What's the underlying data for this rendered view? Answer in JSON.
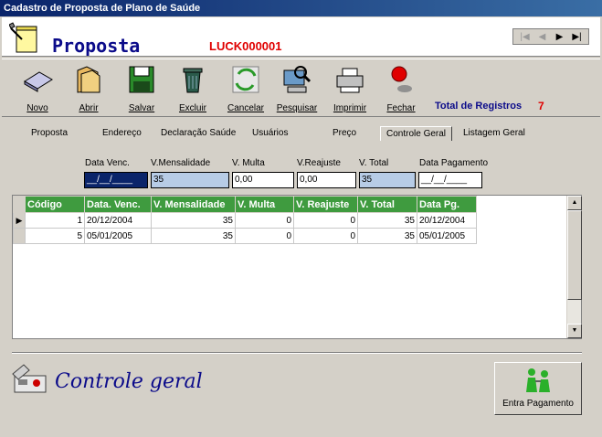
{
  "window": {
    "title": "Cadastro de Proposta de Plano de Saúde"
  },
  "header": {
    "title": "Proposta",
    "code": "LUCK000001"
  },
  "nav": {
    "first": "|◀",
    "prev": "◀",
    "next": "▶",
    "last": "▶|"
  },
  "toolbar": {
    "novo": "Novo",
    "abrir": "Abrir",
    "salvar": "Salvar",
    "excluir": "Excluir",
    "cancelar": "Cancelar",
    "pesquisar": "Pesquisar",
    "imprimir": "Imprimir",
    "fechar": "Fechar",
    "total_label": "Total de Registros",
    "total_value": "7"
  },
  "tabs": [
    "Proposta",
    "Endereço",
    "Declaração Saúde",
    "Usuários",
    "Preço",
    "Controle Geral",
    "Listagem Geral"
  ],
  "form": {
    "labels": {
      "data_venc": "Data Venc.",
      "mensalidade": "V.Mensalidade",
      "multa": "V. Multa",
      "reajuste": "V.Reajuste",
      "total": "V. Total",
      "data_pagamento": "Data Pagamento"
    },
    "values": {
      "data_venc": "__/__/____",
      "mensalidade": "35",
      "multa": "0,00",
      "reajuste": "0,00",
      "total": "35",
      "data_pagamento": "__/__/____"
    }
  },
  "grid": {
    "columns": [
      "Código",
      "Data. Venc.",
      "V. Mensalidade",
      "V. Multa",
      "V. Reajuste",
      "V. Total",
      "Data Pg."
    ],
    "rows": [
      [
        "1",
        "20/12/2004",
        "35",
        "0",
        "0",
        "35",
        "20/12/2004"
      ],
      [
        "5",
        "05/01/2005",
        "35",
        "0",
        "0",
        "35",
        "05/01/2005"
      ]
    ]
  },
  "footer": {
    "title": "Controle geral",
    "pay_button": "Entra Pagamento"
  },
  "colors": {
    "titlebar": "#0a246a",
    "header_title": "#0b0b8a",
    "code": "#e00000",
    "grid_header": "#3f9b3f",
    "field_blue": "#b7cce6"
  }
}
